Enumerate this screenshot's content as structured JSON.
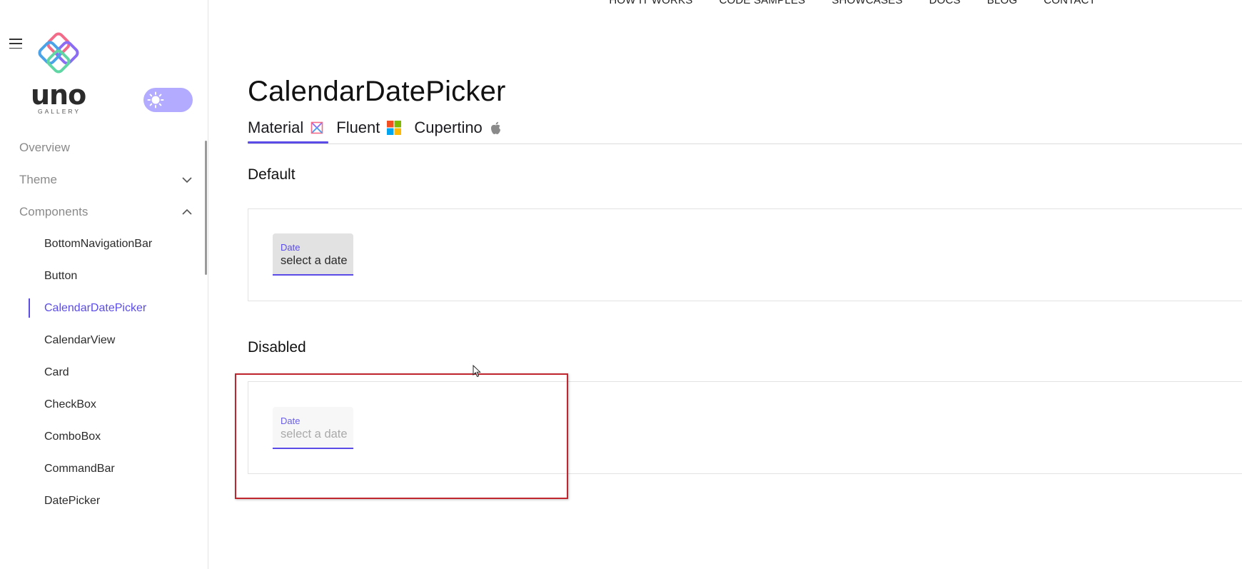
{
  "topnav": {
    "items": [
      "HOW IT WORKS",
      "CODE SAMPLES",
      "SHOWCASES",
      "DOCS",
      "BLOG",
      "CONTACT"
    ]
  },
  "sidebar": {
    "menu_icon": "hamburger-icon",
    "logo": {
      "text": "uno",
      "subtext": "GALLERY"
    },
    "theme_toggle_icon": "sun-icon",
    "sections": [
      {
        "label": "Overview"
      },
      {
        "label": "Theme",
        "icon": "chevron-down-icon"
      },
      {
        "label": "Components",
        "icon": "chevron-up-icon"
      }
    ],
    "components": [
      "BottomNavigationBar",
      "Button",
      "CalendarDatePicker",
      "CalendarView",
      "Card",
      "CheckBox",
      "ComboBox",
      "CommandBar",
      "DatePicker"
    ],
    "active_component": "CalendarDatePicker"
  },
  "main": {
    "title": "CalendarDatePicker",
    "tabs": [
      {
        "label": "Material",
        "icon": "material-icon",
        "selected": true
      },
      {
        "label": "Fluent",
        "icon": "windows-icon",
        "selected": false
      },
      {
        "label": "Cupertino",
        "icon": "apple-icon",
        "selected": false
      }
    ],
    "samples": [
      {
        "title": "Default",
        "field_label": "Date",
        "placeholder": "select a date",
        "disabled": false
      },
      {
        "title": "Disabled",
        "field_label": "Date",
        "placeholder": "select a date",
        "disabled": true
      }
    ]
  },
  "colors": {
    "accent": "#5b4ce8",
    "toggle": "#b3abff",
    "highlight": "#c0262d"
  }
}
